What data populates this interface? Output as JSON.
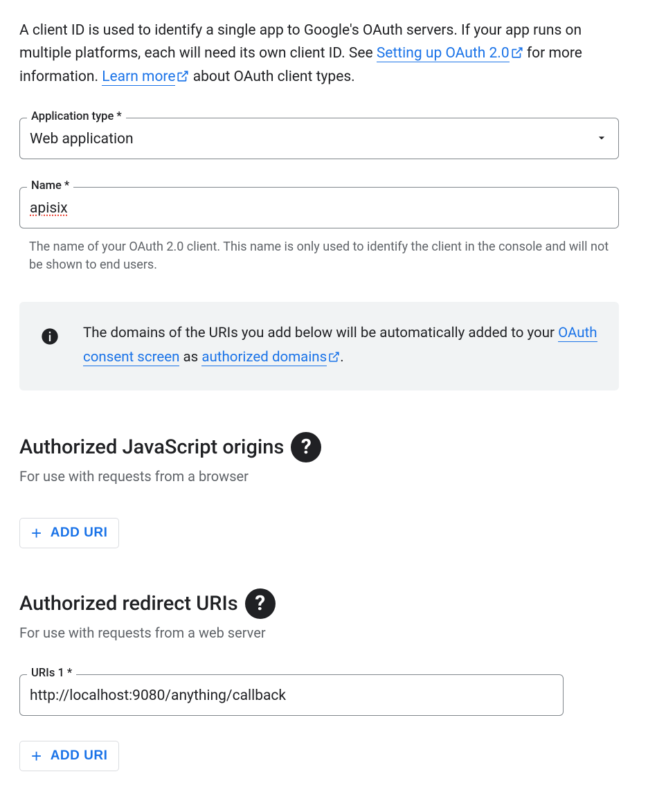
{
  "intro": {
    "part1": "A client ID is used to identify a single app to Google's OAuth servers. If your app runs on multiple platforms, each will need its own client ID. See ",
    "link1": "Setting up OAuth 2.0",
    "part2": "for more information. ",
    "link2": "Learn more",
    "part3": "about OAuth client types."
  },
  "fields": {
    "app_type": {
      "label": "Application type *",
      "value": "Web application"
    },
    "name": {
      "label": "Name *",
      "value": "apisix",
      "hint": "The name of your OAuth 2.0 client. This name is only used to identify the client in the console and will not be shown to end users."
    }
  },
  "info": {
    "part1": "The domains of the URIs you add below will be automatically added to your ",
    "link1": "OAuth consent screen",
    "part2": " as ",
    "link2": "authorized domains",
    "part3": "."
  },
  "js_origins": {
    "title": "Authorized JavaScript origins",
    "sub": "For use with requests from a browser",
    "add_label": "ADD URI"
  },
  "redirect_uris": {
    "title": "Authorized redirect URIs",
    "sub": "For use with requests from a web server",
    "uri1_label": "URIs 1 *",
    "uri1_value": "http://localhost:9080/anything/callback",
    "add_label": "ADD URI"
  },
  "glyphs": {
    "help": "?",
    "plus": "+"
  }
}
